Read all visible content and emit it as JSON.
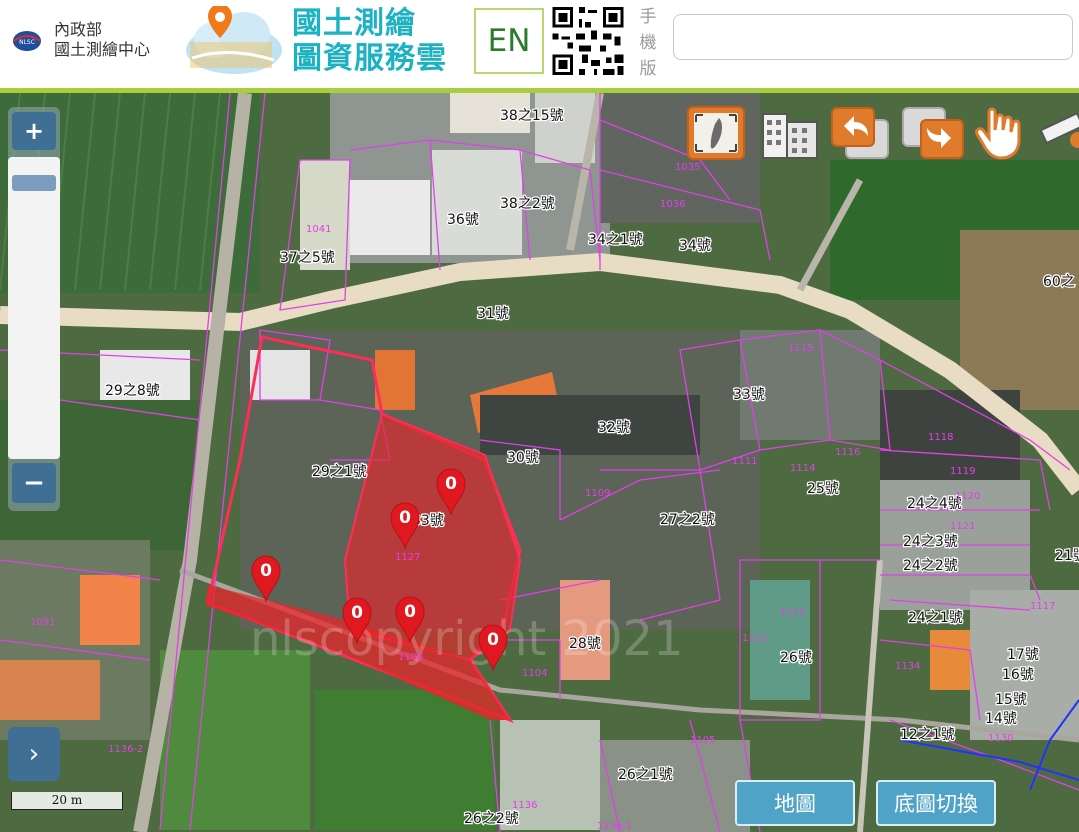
{
  "header": {
    "org_line1": "內政部",
    "org_line2": "國土測繪中心",
    "nlsc_logo_text": "NLSC",
    "service_title_line1": "國土測繪",
    "service_title_line2": "圖資服務雲",
    "en_button": "EN",
    "mobile_label": [
      "手",
      "機",
      "版"
    ],
    "search_placeholder": ""
  },
  "map": {
    "watermark": "nlscopyright 2021",
    "place_labels": [
      "38之15號",
      "36號",
      "38之2號",
      "34之1號",
      "34號",
      "37之5號",
      "31號",
      "60之",
      "29之8號",
      "33號",
      "32號",
      "30號",
      "29之1號",
      "33號",
      "27之2號",
      "25號",
      "24之4號",
      "24之3號",
      "24之2號",
      "24之1號",
      "28號",
      "26號",
      "21號",
      "17號",
      "16號",
      "15號",
      "14號",
      "12之1號",
      "26之1號",
      "26之2號"
    ],
    "lot_numbers": [
      "1035",
      "1036",
      "1041",
      "1115",
      "1116",
      "1118",
      "1119",
      "1120",
      "1121",
      "1114",
      "1111",
      "1109",
      "1113",
      "1112",
      "1104",
      "1091",
      "1134",
      "1130",
      "1117",
      "1127",
      "1106",
      "1105",
      "1136",
      "1136-1",
      "1136-2",
      "1094"
    ],
    "marker_count": 7,
    "marker_glyph": "0",
    "marker_labels": [
      "1106",
      "1105"
    ]
  },
  "controls": {
    "zoom_in": "+",
    "zoom_out": "−",
    "expand": "›",
    "scale": "20 m",
    "toolbar": [
      {
        "name": "full-extent",
        "icon": "taiwan-map-icon"
      },
      {
        "name": "buildings",
        "icon": "buildings-icon"
      },
      {
        "name": "back",
        "icon": "undo-arrow-icon"
      },
      {
        "name": "forward",
        "icon": "redo-arrow-icon"
      },
      {
        "name": "pan",
        "icon": "hand-pointer-icon"
      },
      {
        "name": "measure",
        "icon": "ruler-icon"
      }
    ],
    "map_button": "地圖",
    "basemap_button": "底圖切換"
  },
  "colors": {
    "header_accent": "#a7cf3b",
    "title_teal": "#1bb3c4",
    "control_blue": "#3f6f95",
    "button_blue": "#4fa3c7",
    "parcel_line": "#e040e8",
    "selection_red": "#e8262b",
    "road": "#e8dcc4"
  }
}
